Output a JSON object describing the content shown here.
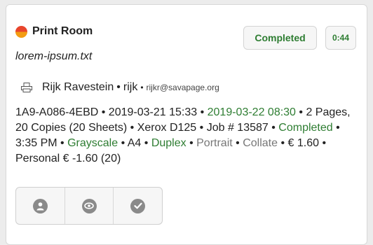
{
  "job": {
    "printer_title": "Print Room",
    "document_name": "lorem-ipsum.txt",
    "status_badge": "Completed",
    "elapsed_badge": "0:44",
    "user_name": "Rijk Ravestein",
    "user_id": "rijk",
    "user_email": "rijkr@savapage.org",
    "job_id": "1A9-A086-4EBD",
    "submitted": "2019-03-21 15:33",
    "completed_at": "2019-03-22 08:30",
    "pages_copies": "2 Pages, 20 Copies (20 Sheets)",
    "printer_model": "Xerox D125",
    "job_number": "Job # 13587",
    "status": "Completed",
    "status_time": "3:35 PM",
    "color_mode": "Grayscale",
    "paper": "A4",
    "duplex": "Duplex",
    "orientation": "Portrait",
    "collate": "Collate",
    "cost": "€ 1.60",
    "account": "Personal € -1.60 (20)"
  },
  "actions": [
    {
      "icon": "user-icon"
    },
    {
      "icon": "eye-icon"
    },
    {
      "icon": "check-icon"
    }
  ],
  "colors": {
    "success_green": "#2e7d32",
    "muted_gray": "#777777",
    "icon_gray": "#8a8a8a"
  }
}
